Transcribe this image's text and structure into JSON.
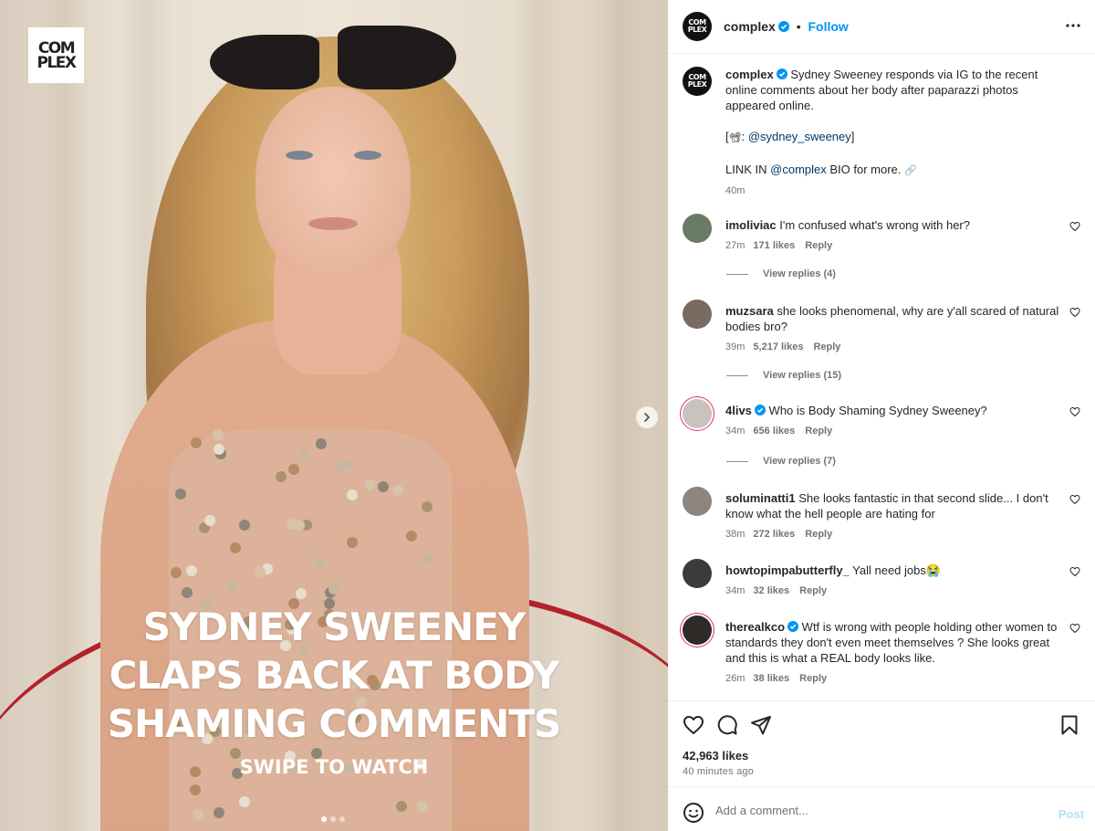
{
  "media": {
    "logo_text": "COM\nPLEX",
    "headline_lines": [
      "SYDNEY SWEENEY",
      "CLAPS BACK AT BODY",
      "SHAMING COMMENTS"
    ],
    "swipe_text": "SWIPE TO WATCH",
    "carousel_count": 3,
    "carousel_active_index": 0
  },
  "header": {
    "avatar_text": "COM\nPLEX",
    "username": "complex",
    "separator": "•",
    "follow_label": "Follow"
  },
  "caption": {
    "username": "complex",
    "text": "Sydney Sweeney responds via IG to the recent online comments about her body after paparazzi photos appeared online.",
    "credit_prefix": "[",
    "credit_icon": "📽",
    "credit_colon": ":",
    "credit_mention": "@sydney_sweeney",
    "credit_suffix": "]",
    "link_prefix": "LINK IN",
    "link_mention": "@complex",
    "link_suffix": "BIO for more.",
    "link_icon": "🔗",
    "time": "40m"
  },
  "comments": [
    {
      "username": "imoliviac",
      "verified": false,
      "text": "I'm confused what's wrong with her?",
      "time": "27m",
      "likes": "171 likes",
      "reply": "Reply",
      "view_replies": "View replies (4)",
      "avatar_color": "#6a7b64"
    },
    {
      "username": "muzsara",
      "verified": false,
      "text": "she looks phenomenal, why are y'all scared of natural bodies bro?",
      "time": "39m",
      "likes": "5,217 likes",
      "reply": "Reply",
      "view_replies": "View replies (15)",
      "avatar_color": "#7a6a62"
    },
    {
      "username": "4livs",
      "verified": true,
      "text": "Who is Body Shaming Sydney Sweeney?",
      "time": "34m",
      "likes": "656 likes",
      "reply": "Reply",
      "view_replies": "View replies (7)",
      "avatar_color": "#c9c2bd"
    },
    {
      "username": "soluminatti1",
      "verified": false,
      "text": "She looks fantastic in that second slide... I don't know what the hell people are hating for",
      "time": "38m",
      "likes": "272 likes",
      "reply": "Reply",
      "view_replies": "",
      "avatar_color": "#8c8580"
    },
    {
      "username": "howtopimpabutterfly_",
      "verified": false,
      "text": "Yall need jobs",
      "emoji": "😭",
      "time": "34m",
      "likes": "32 likes",
      "reply": "Reply",
      "view_replies": "",
      "avatar_color": "#3b3b3b"
    },
    {
      "username": "therealkco",
      "verified": true,
      "text": "Wtf is wrong with people holding other women to standards they don't even meet themselves ? She looks great and this is what a REAL body looks like.",
      "time": "26m",
      "likes": "38 likes",
      "reply": "Reply",
      "view_replies": "",
      "avatar_color": "#2e2a28"
    }
  ],
  "actions": {
    "likes": "42,963 likes",
    "time": "40 minutes ago"
  },
  "comment_box": {
    "placeholder": "Add a comment...",
    "post_label": "Post"
  },
  "colors": {
    "accent": "#0095f6",
    "mention": "#00376b",
    "muted": "#737373",
    "post_disabled": "#b2dffc",
    "rope": "#b3212a"
  },
  "icons": [
    "verified-badge-icon",
    "more-options-icon",
    "heart-icon",
    "comment-icon",
    "share-icon",
    "bookmark-icon",
    "emoji-icon",
    "chevron-right-icon",
    "link-icon",
    "camera-icon"
  ]
}
